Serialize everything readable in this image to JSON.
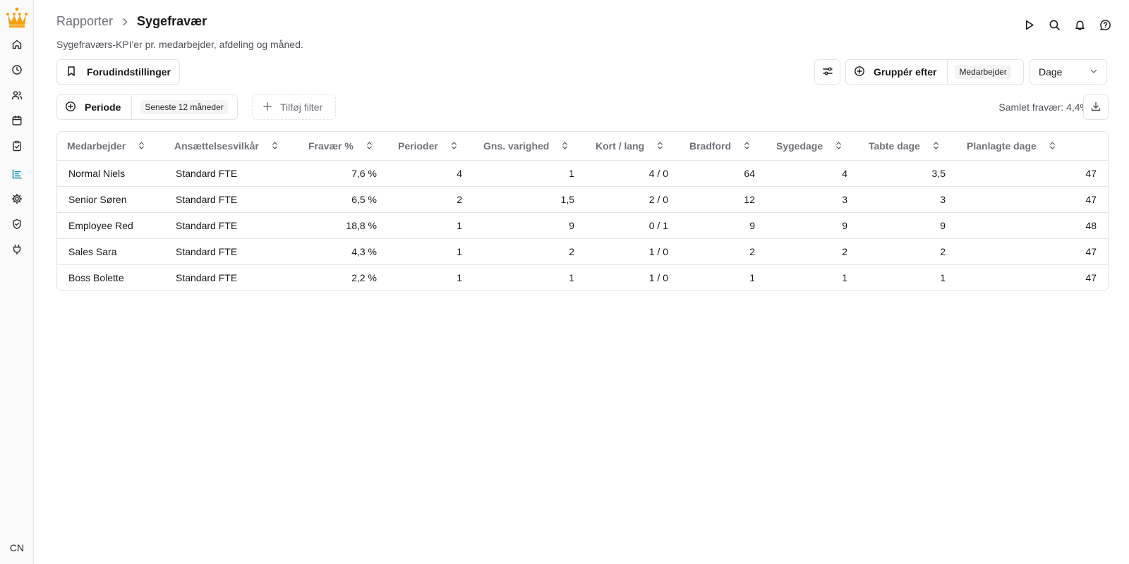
{
  "sidebar": {
    "items": [
      {
        "name": "home-icon"
      },
      {
        "name": "clock-icon"
      },
      {
        "name": "users-icon"
      },
      {
        "name": "calendar-icon"
      },
      {
        "name": "clipboard-check-icon"
      },
      {
        "name": "reports-icon",
        "active": true
      },
      {
        "name": "gear-icon"
      },
      {
        "name": "shield-check-icon"
      },
      {
        "name": "plug-icon"
      }
    ],
    "user_initials": "CN",
    "active_color": "#0891b2",
    "logo_color": "#f59e0b"
  },
  "header": {
    "breadcrumb_parent": "Rapporter",
    "title": "Sygefravær",
    "subtitle": "Sygefraværs-KPI'er pr. medarbejder, afdeling og måned."
  },
  "toolbar": {
    "presets_label": "Forudindstillinger",
    "group_by_label": "Gruppér efter",
    "group_by_value": "Medarbejder",
    "unit_value": "Dage",
    "period_label": "Periode",
    "period_value": "Seneste 12 måneder",
    "add_filter_label": "Tilføj filter",
    "total_absence": "Samlet fravær: 4,4%"
  },
  "table": {
    "columns": [
      "Medarbejder",
      "Ansættelsesvilkår",
      "Fravær %",
      "Perioder",
      "Gns. varighed",
      "Kort / lang",
      "Bradford",
      "Sygedage",
      "Tabte dage",
      "Planlagte dage"
    ],
    "rows": [
      [
        "Normal Niels",
        "Standard FTE",
        "7,6 %",
        "4",
        "1",
        "4 / 0",
        "64",
        "4",
        "3,5",
        "47"
      ],
      [
        "Senior Søren",
        "Standard FTE",
        "6,5 %",
        "2",
        "1,5",
        "2 / 0",
        "12",
        "3",
        "3",
        "47"
      ],
      [
        "Employee Red",
        "Standard FTE",
        "18,8 %",
        "1",
        "9",
        "0 / 1",
        "9",
        "9",
        "9",
        "48"
      ],
      [
        "Sales Sara",
        "Standard FTE",
        "4,3 %",
        "1",
        "2",
        "1 / 0",
        "2",
        "2",
        "2",
        "47"
      ],
      [
        "Boss Bolette",
        "Standard FTE",
        "2,2 %",
        "1",
        "1",
        "1 / 0",
        "1",
        "1",
        "1",
        "47"
      ]
    ]
  }
}
